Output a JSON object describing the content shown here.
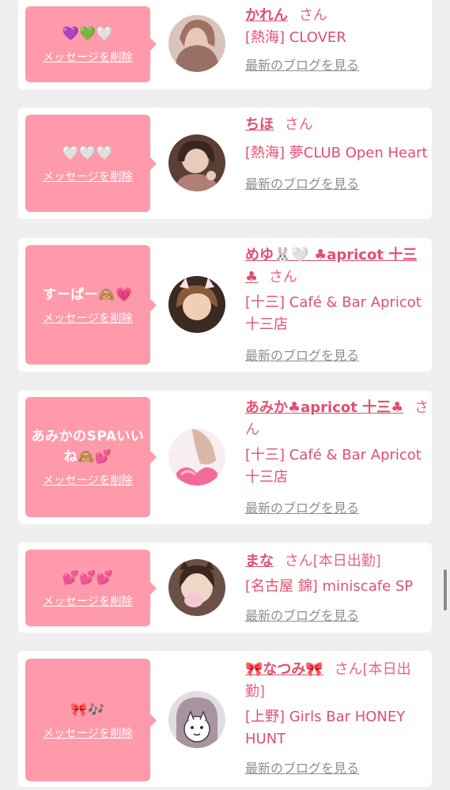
{
  "cards": [
    {
      "message": "💜💚🤍",
      "delete_label": "メッセージを削除",
      "name": "かれん",
      "suffix": "さん",
      "shop": "[熱海] CLOVER",
      "blog_label": "最新のブログを見る",
      "avatar_color": "#b58a7e"
    },
    {
      "message": "🤍🤍🤍",
      "delete_label": "メッセージを削除",
      "name": "ちほ",
      "suffix": "さん",
      "shop": "[熱海] 夢CLUB Open Heart",
      "blog_label": "最新のブログを見る",
      "avatar_color": "#7a5a4c"
    },
    {
      "message": "すーぱー🙈💗",
      "delete_label": "メッセージを削除",
      "name": "めゆ🐰🤍 ♣apricot 十三♣",
      "suffix": "さん",
      "shop": "[十三] Café & Bar Apricot 十三店",
      "blog_label": "最新のブログを見る",
      "avatar_color": "#6c4a34"
    },
    {
      "message": "あみかのSPAいいね🙈💕",
      "delete_label": "メッセージを削除",
      "name": "あみか♣apricot 十三♣",
      "suffix": "さん",
      "shop": "[十三] Café & Bar Apricot 十三店",
      "blog_label": "最新のブログを見る",
      "avatar_color": "#f2d8dc"
    },
    {
      "message": "💕💕💕",
      "delete_label": "メッセージを削除",
      "name": "まな",
      "suffix": "さん[本日出勤]",
      "shop": "[名古屋 錦] miniscafe SP",
      "blog_label": "最新のブログを見る",
      "avatar_color": "#8c6e5e"
    },
    {
      "message": "🎀🎶",
      "delete_label": "メッセージを削除",
      "name": "🎀なつみ🎀",
      "suffix": "さん[本日出勤]",
      "shop": "[上野] Girls Bar HONEY HUNT",
      "blog_label": "最新のブログを見る",
      "avatar_color": "#c9bcc2"
    }
  ]
}
